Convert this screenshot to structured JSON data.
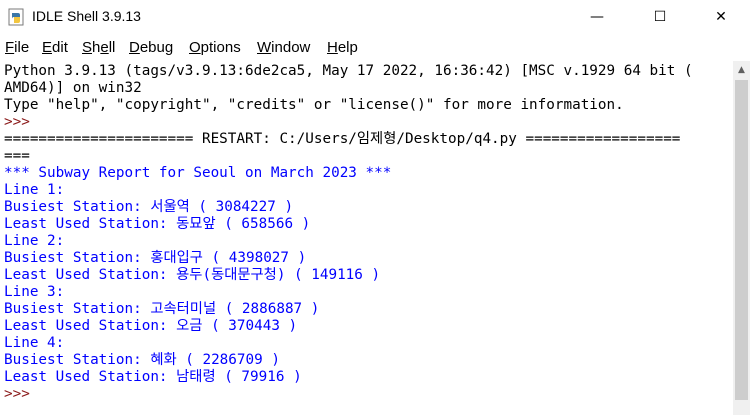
{
  "window": {
    "title": "IDLE Shell 3.9.13",
    "min_glyph": "—",
    "max_glyph": "☐",
    "close_glyph": "✕"
  },
  "menu": {
    "file": "File",
    "edit": "Edit",
    "shell_a": "Sh",
    "shell_b": "e",
    "shell_c": "ll",
    "debug": "Debug",
    "options": "Options",
    "window": "Window",
    "help": "Help"
  },
  "console": {
    "lines": [
      "Python 3.9.13 (tags/v3.9.13:6de2ca5, May 17 2022, 16:36:42) [MSC v.1929 64 bit (",
      "AMD64)] on win32",
      "Type \"help\", \"copyright\", \"credits\" or \"license()\" for more information.",
      ">>> ",
      "====================== RESTART: C:/Users/임제형/Desktop/q4.py ==================",
      "===",
      "*** Subway Report for Seoul on March 2023 ***",
      "Line 1:",
      "Busiest Station: 서울역 ( 3084227 )",
      "Least Used Station: 동묘앞 ( 658566 )",
      "Line 2:",
      "Busiest Station: 홍대입구 ( 4398027 )",
      "Least Used Station: 용두(동대문구청) ( 149116 )",
      "Line 3:",
      "Busiest Station: 고속터미널 ( 2886887 )",
      "Least Used Station: 오금 ( 370443 )",
      "Line 4:",
      "Busiest Station: 혜화 ( 2286709 )",
      "Least Used Station: 남태령 ( 79916 )",
      ">>> "
    ]
  },
  "colors": {
    "output": "#0000ff",
    "prompt": "#8b1a1a",
    "text": "#000000"
  }
}
